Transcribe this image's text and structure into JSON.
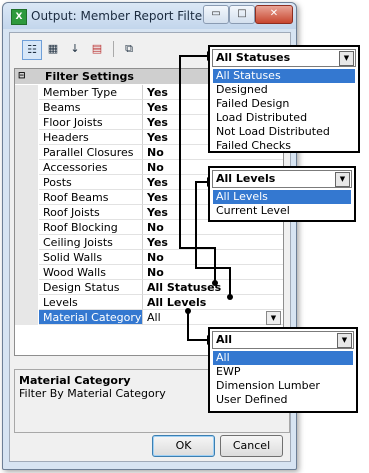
{
  "window": {
    "title": "Output: Member Report Filter",
    "app_icon": "excel-like-icon"
  },
  "titlebar_buttons": {
    "minimize": "▭",
    "maximize": "□",
    "close": "✕"
  },
  "toolbar": {
    "icons": [
      "categorized-icon",
      "alphabetical-icon",
      "sort-az-icon",
      "delete-icon",
      "property-pages-icon"
    ]
  },
  "grid": {
    "category": "Filter Settings",
    "rows": [
      {
        "name": "Member Type",
        "value": "Yes"
      },
      {
        "name": "Beams",
        "value": "Yes"
      },
      {
        "name": "Floor Joists",
        "value": "Yes"
      },
      {
        "name": "Headers",
        "value": "Yes"
      },
      {
        "name": "Parallel Closures",
        "value": "No"
      },
      {
        "name": "Accessories",
        "value": "No"
      },
      {
        "name": "Posts",
        "value": "Yes"
      },
      {
        "name": "Roof Beams",
        "value": "Yes"
      },
      {
        "name": "Roof Joists",
        "value": "Yes"
      },
      {
        "name": "Roof Blocking",
        "value": "No"
      },
      {
        "name": "Ceiling Joists",
        "value": "Yes"
      },
      {
        "name": "Solid Walls",
        "value": "No"
      },
      {
        "name": "Wood Walls",
        "value": "No"
      },
      {
        "name": "Design Status",
        "value": "All Statuses"
      },
      {
        "name": "Levels",
        "value": "All Levels"
      },
      {
        "name": "Material Category",
        "value": "All"
      }
    ]
  },
  "description": {
    "title": "Material Category",
    "text": "Filter By Material Category"
  },
  "buttons": {
    "ok": "OK",
    "cancel": "Cancel"
  },
  "popups": {
    "statuses": {
      "header": "All Statuses",
      "items": [
        "All Statuses",
        "Designed",
        "Failed Design",
        "Load Distributed",
        "Not Load Distributed",
        "Failed Checks"
      ]
    },
    "levels": {
      "header": "All Levels",
      "items": [
        "All Levels",
        "Current Level"
      ]
    },
    "material": {
      "header": "All",
      "items": [
        "All",
        "EWP",
        "Dimension Lumber",
        "User Defined"
      ]
    }
  },
  "colors": {
    "selection": "#3478d0",
    "window_frame": "#d7e4f2"
  }
}
